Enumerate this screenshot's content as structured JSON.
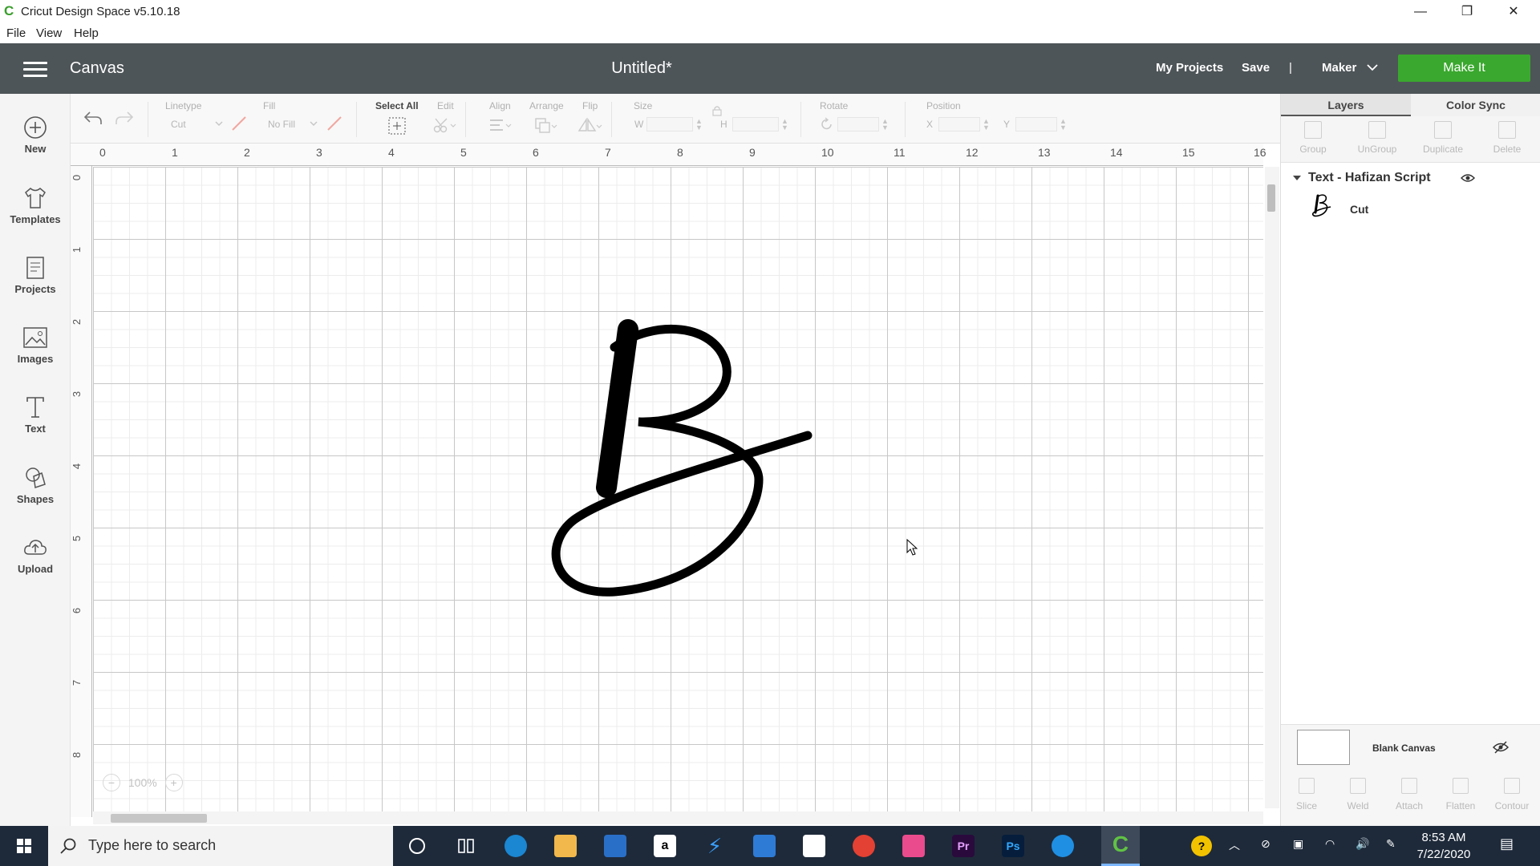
{
  "window": {
    "title": "Cricut Design Space  v5.10.18",
    "controls": [
      "—",
      "❐",
      "✕"
    ]
  },
  "menu": [
    "File",
    "View",
    "Help"
  ],
  "header": {
    "section": "Canvas",
    "doc_title": "Untitled*",
    "my_projects": "My Projects",
    "save": "Save",
    "divider": "|",
    "machine": "Maker",
    "make_it": "Make It"
  },
  "sidebar": [
    {
      "label": "New",
      "icon": "plus-circle-icon"
    },
    {
      "label": "Templates",
      "icon": "tshirt-icon"
    },
    {
      "label": "Projects",
      "icon": "projects-icon"
    },
    {
      "label": "Images",
      "icon": "image-icon"
    },
    {
      "label": "Text",
      "icon": "text-icon"
    },
    {
      "label": "Shapes",
      "icon": "shapes-icon"
    },
    {
      "label": "Upload",
      "icon": "cloud-upload-icon"
    }
  ],
  "toolbar": {
    "linetype_label": "Linetype",
    "linetype_value": "Cut",
    "fill_label": "Fill",
    "fill_value": "No Fill",
    "select_all": "Select All",
    "edit": "Edit",
    "align": "Align",
    "arrange": "Arrange",
    "flip": "Flip",
    "size": "Size",
    "w": "W",
    "h": "H",
    "rotate": "Rotate",
    "position": "Position",
    "x": "X",
    "y": "Y"
  },
  "ruler": {
    "h": [
      "0",
      "1",
      "2",
      "3",
      "4",
      "5",
      "6",
      "7",
      "8",
      "9",
      "10",
      "11",
      "12",
      "13",
      "14",
      "15",
      "16"
    ],
    "v": [
      "0",
      "1",
      "2",
      "3",
      "4",
      "5",
      "6",
      "7",
      "8"
    ]
  },
  "zoom": "100%",
  "panel": {
    "tabs": [
      "Layers",
      "Color Sync"
    ],
    "tools": [
      "Group",
      "UnGroup",
      "Duplicate",
      "Delete"
    ],
    "layer_group": "Text - Hafizan Script",
    "layer_item": "Cut",
    "blank_canvas": "Blank Canvas",
    "bottom_tools": [
      "Slice",
      "Weld",
      "Attach",
      "Flatten",
      "Contour"
    ]
  },
  "taskbar": {
    "search_placeholder": "Type here to search",
    "time": "8:53 AM",
    "date": "7/22/2020"
  },
  "colors": {
    "header": "#4e5558",
    "make_it": "#3aa82e",
    "taskbar": "#1e2a3a"
  }
}
